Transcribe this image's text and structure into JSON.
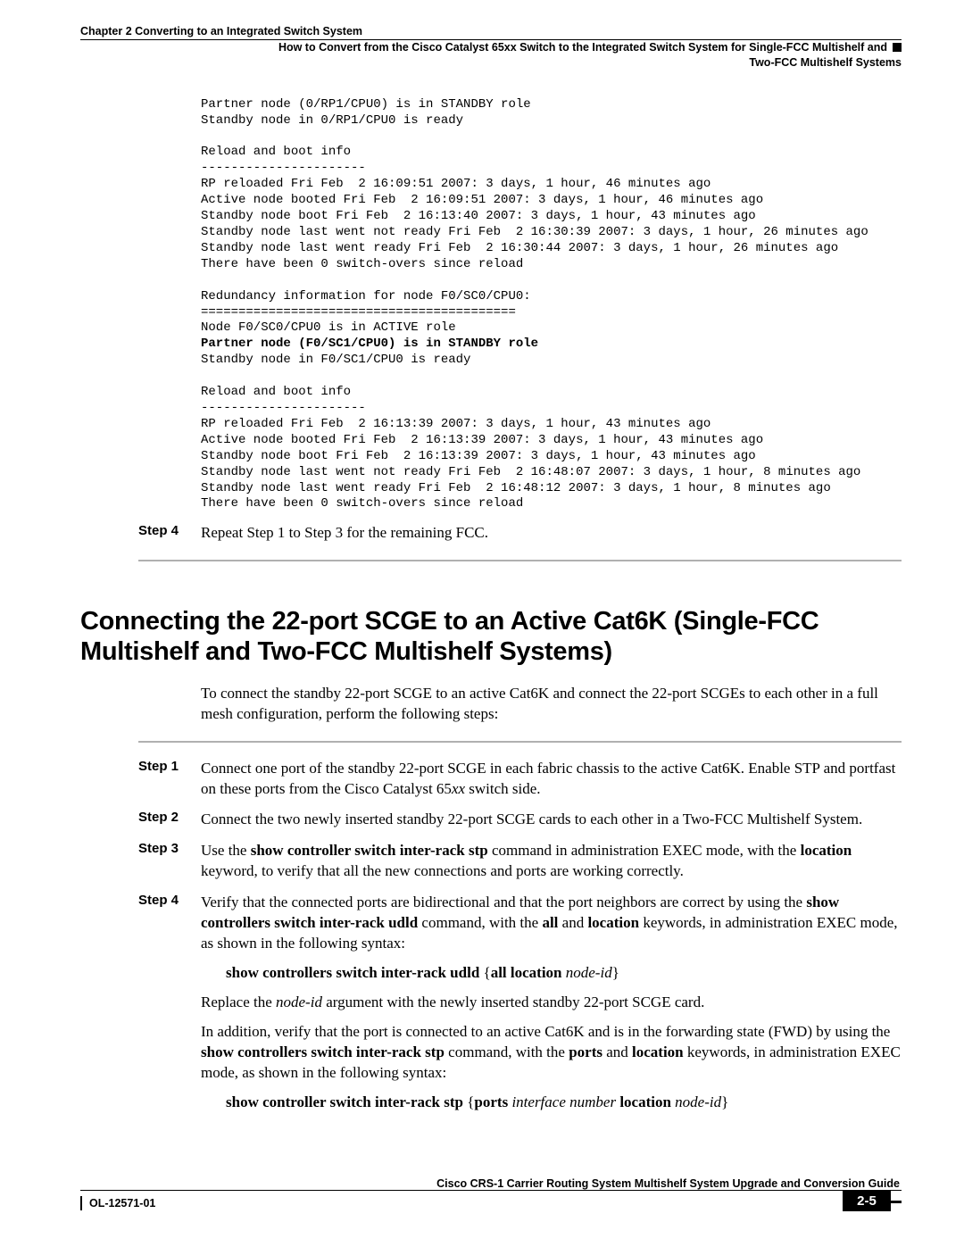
{
  "header": {
    "chapter": "Chapter 2    Converting to an Integrated Switch System",
    "subtitle_line1": "How to Convert from the Cisco Catalyst 65xx Switch to the Integrated Switch System for Single-FCC Multishelf and",
    "subtitle_line2": "Two-FCC Multishelf Systems"
  },
  "terminal_block1": {
    "l1": "Partner node (0/RP1/CPU0) is in STANDBY role",
    "l2": "Standby node in 0/RP1/CPU0 is ready",
    "l3": "",
    "l4": "Reload and boot info",
    "l5": "----------------------",
    "l6": "RP reloaded Fri Feb  2 16:09:51 2007: 3 days, 1 hour, 46 minutes ago",
    "l7": "Active node booted Fri Feb  2 16:09:51 2007: 3 days, 1 hour, 46 minutes ago",
    "l8": "Standby node boot Fri Feb  2 16:13:40 2007: 3 days, 1 hour, 43 minutes ago",
    "l9": "Standby node last went not ready Fri Feb  2 16:30:39 2007: 3 days, 1 hour, 26 minutes ago",
    "l10": "Standby node last went ready Fri Feb  2 16:30:44 2007: 3 days, 1 hour, 26 minutes ago",
    "l11": "There have been 0 switch-overs since reload",
    "l12": "",
    "l13": "Redundancy information for node F0/SC0/CPU0:",
    "l14": "==========================================",
    "l15": "Node F0/SC0/CPU0 is in ACTIVE role",
    "l16b": "Partner node (F0/SC1/CPU0) is in STANDBY role",
    "l17": "Standby node in F0/SC1/CPU0 is ready",
    "l18": "",
    "l19": "Reload and boot info",
    "l20": "----------------------",
    "l21": "RP reloaded Fri Feb  2 16:13:39 2007: 3 days, 1 hour, 43 minutes ago",
    "l22": "Active node booted Fri Feb  2 16:13:39 2007: 3 days, 1 hour, 43 minutes ago",
    "l23": "Standby node boot Fri Feb  2 16:13:39 2007: 3 days, 1 hour, 43 minutes ago",
    "l24": "Standby node last went not ready Fri Feb  2 16:48:07 2007: 3 days, 1 hour, 8 minutes ago",
    "l25": "Standby node last went ready Fri Feb  2 16:48:12 2007: 3 days, 1 hour, 8 minutes ago",
    "l26": "There have been 0 switch-overs since reload"
  },
  "step4a": {
    "label": "Step 4",
    "text": "Repeat Step 1 to Step 3 for the remaining FCC."
  },
  "section2": {
    "title": "Connecting the 22-port SCGE to an Active Cat6K (Single-FCC Multishelf and Two-FCC Multishelf Systems)",
    "intro": "To connect the standby 22-port SCGE to an active Cat6K and connect the 22-port SCGEs to each other in a full mesh configuration, perform the following steps:",
    "steps": {
      "s1": {
        "label": "Step 1",
        "t1": "Connect one port of the standby 22-port SCGE in each fabric chassis to the active Cat6K. Enable STP and portfast on these ports from the Cisco Catalyst 65",
        "it1": "xx",
        "t2": " switch side."
      },
      "s2": {
        "label": "Step 2",
        "t1": "Connect the two newly inserted standby 22-port SCGE cards to each other in a Two-FCC Multishelf System."
      },
      "s3": {
        "label": "Step 3",
        "t1": "Use the ",
        "b1": "show controller switch inter-rack stp",
        "t2": " command in administration EXEC mode, with the ",
        "b2": "location",
        "t3": " keyword, to verify that all the new connections and ports are working correctly."
      },
      "s4": {
        "label": "Step 4",
        "p1_t1": "Verify that the connected ports are bidirectional and that the port neighbors are correct by using the ",
        "p1_b1": "show controllers switch inter-rack udld",
        "p1_t2": " command, with the ",
        "p1_b2": "all",
        "p1_t3": " and ",
        "p1_b3": "location",
        "p1_t4": " keywords, in administration EXEC mode, as shown in the following syntax:",
        "cmd1_b1": "show controllers switch inter-rack udld ",
        "cmd1_t1": "{",
        "cmd1_b2": "all location ",
        "cmd1_i1": "node-id",
        "cmd1_t2": "}",
        "p2_t1": "Replace the ",
        "p2_i1": "node-id",
        "p2_t2": " argument with the newly inserted standby 22-port SCGE card.",
        "p3_t1": "In addition, verify that the port is connected to an active Cat6K and is in the forwarding state (FWD) by using the ",
        "p3_b1": "show controllers switch inter-rack stp",
        "p3_t2": " command, with the ",
        "p3_b2": "ports",
        "p3_t3": " and ",
        "p3_b3": "location",
        "p3_t4": " keywords, in administration EXEC mode, as shown in the following syntax:",
        "cmd2_b1": "show controller switch inter-rack stp ",
        "cmd2_t1": "{",
        "cmd2_b2": "ports ",
        "cmd2_i1": "interface number ",
        "cmd2_b3": "location ",
        "cmd2_i2": "node-id",
        "cmd2_t2": "}"
      }
    }
  },
  "footer": {
    "doc_title": "Cisco CRS-1 Carrier Routing System Multishelf System Upgrade and Conversion Guide",
    "doc_code": "OL-12571-01",
    "page_number": "2-5"
  }
}
